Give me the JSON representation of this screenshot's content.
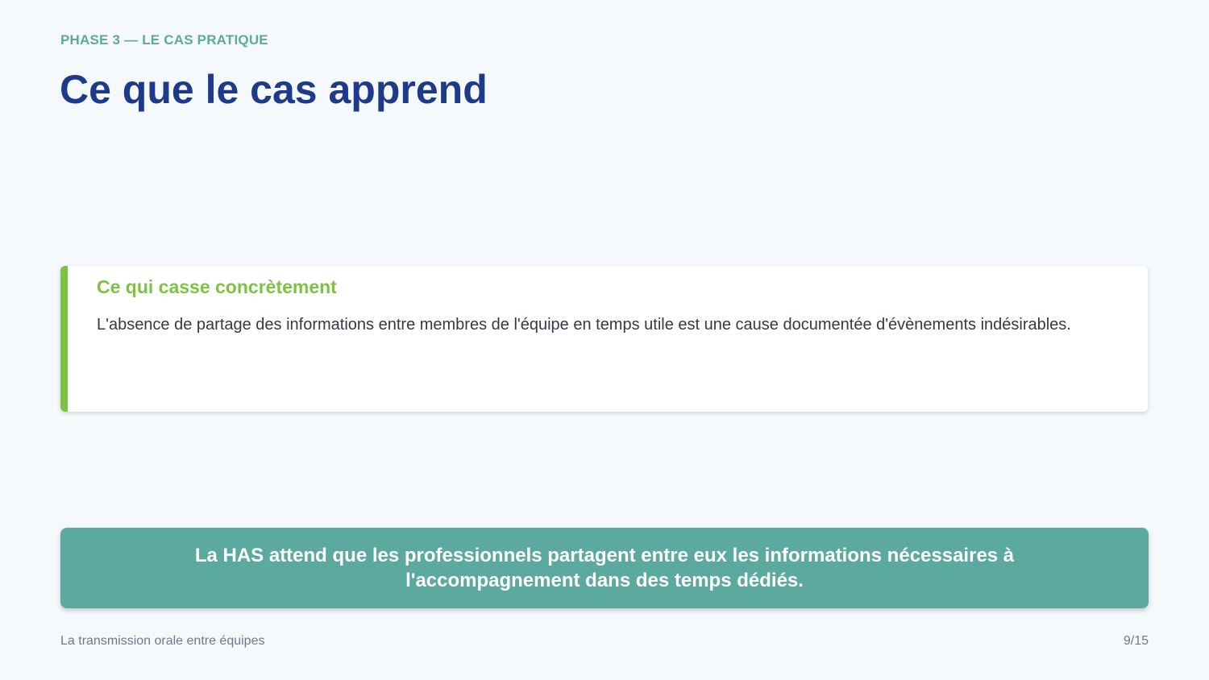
{
  "header": {
    "eyebrow": "PHASE 3 — LE CAS PRATIQUE",
    "title": "Ce que le cas apprend"
  },
  "card": {
    "heading": "Ce qui casse concrètement",
    "body": "L'absence de partage des informations entre membres de l'équipe en temps utile est une cause documentée d'évènements indésirables."
  },
  "banner": {
    "text": "La HAS attend que les professionnels partagent entre eux les informations nécessaires à l'accompagnement dans des temps dédiés."
  },
  "footer": {
    "deck_title": "La transmission orale entre équipes",
    "page_indicator": "9/15"
  },
  "colors": {
    "background": "#f5f9fc",
    "eyebrow": "#5ba99f",
    "title": "#1e3a8a",
    "card_accent": "#7dc242",
    "banner": "#5ba99f"
  }
}
